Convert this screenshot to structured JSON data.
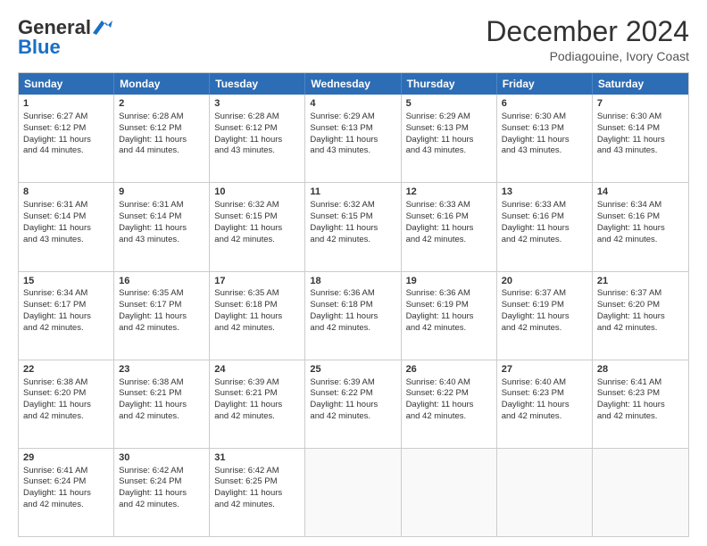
{
  "header": {
    "logo_general": "General",
    "logo_blue": "Blue",
    "month_title": "December 2024",
    "location": "Podiagouine, Ivory Coast"
  },
  "calendar": {
    "days_of_week": [
      "Sunday",
      "Monday",
      "Tuesday",
      "Wednesday",
      "Thursday",
      "Friday",
      "Saturday"
    ],
    "rows": [
      [
        {
          "num": "1",
          "info": "Sunrise: 6:27 AM\nSunset: 6:12 PM\nDaylight: 11 hours\nand 44 minutes."
        },
        {
          "num": "2",
          "info": "Sunrise: 6:28 AM\nSunset: 6:12 PM\nDaylight: 11 hours\nand 44 minutes."
        },
        {
          "num": "3",
          "info": "Sunrise: 6:28 AM\nSunset: 6:12 PM\nDaylight: 11 hours\nand 43 minutes."
        },
        {
          "num": "4",
          "info": "Sunrise: 6:29 AM\nSunset: 6:13 PM\nDaylight: 11 hours\nand 43 minutes."
        },
        {
          "num": "5",
          "info": "Sunrise: 6:29 AM\nSunset: 6:13 PM\nDaylight: 11 hours\nand 43 minutes."
        },
        {
          "num": "6",
          "info": "Sunrise: 6:30 AM\nSunset: 6:13 PM\nDaylight: 11 hours\nand 43 minutes."
        },
        {
          "num": "7",
          "info": "Sunrise: 6:30 AM\nSunset: 6:14 PM\nDaylight: 11 hours\nand 43 minutes."
        }
      ],
      [
        {
          "num": "8",
          "info": "Sunrise: 6:31 AM\nSunset: 6:14 PM\nDaylight: 11 hours\nand 43 minutes."
        },
        {
          "num": "9",
          "info": "Sunrise: 6:31 AM\nSunset: 6:14 PM\nDaylight: 11 hours\nand 43 minutes."
        },
        {
          "num": "10",
          "info": "Sunrise: 6:32 AM\nSunset: 6:15 PM\nDaylight: 11 hours\nand 42 minutes."
        },
        {
          "num": "11",
          "info": "Sunrise: 6:32 AM\nSunset: 6:15 PM\nDaylight: 11 hours\nand 42 minutes."
        },
        {
          "num": "12",
          "info": "Sunrise: 6:33 AM\nSunset: 6:16 PM\nDaylight: 11 hours\nand 42 minutes."
        },
        {
          "num": "13",
          "info": "Sunrise: 6:33 AM\nSunset: 6:16 PM\nDaylight: 11 hours\nand 42 minutes."
        },
        {
          "num": "14",
          "info": "Sunrise: 6:34 AM\nSunset: 6:16 PM\nDaylight: 11 hours\nand 42 minutes."
        }
      ],
      [
        {
          "num": "15",
          "info": "Sunrise: 6:34 AM\nSunset: 6:17 PM\nDaylight: 11 hours\nand 42 minutes."
        },
        {
          "num": "16",
          "info": "Sunrise: 6:35 AM\nSunset: 6:17 PM\nDaylight: 11 hours\nand 42 minutes."
        },
        {
          "num": "17",
          "info": "Sunrise: 6:35 AM\nSunset: 6:18 PM\nDaylight: 11 hours\nand 42 minutes."
        },
        {
          "num": "18",
          "info": "Sunrise: 6:36 AM\nSunset: 6:18 PM\nDaylight: 11 hours\nand 42 minutes."
        },
        {
          "num": "19",
          "info": "Sunrise: 6:36 AM\nSunset: 6:19 PM\nDaylight: 11 hours\nand 42 minutes."
        },
        {
          "num": "20",
          "info": "Sunrise: 6:37 AM\nSunset: 6:19 PM\nDaylight: 11 hours\nand 42 minutes."
        },
        {
          "num": "21",
          "info": "Sunrise: 6:37 AM\nSunset: 6:20 PM\nDaylight: 11 hours\nand 42 minutes."
        }
      ],
      [
        {
          "num": "22",
          "info": "Sunrise: 6:38 AM\nSunset: 6:20 PM\nDaylight: 11 hours\nand 42 minutes."
        },
        {
          "num": "23",
          "info": "Sunrise: 6:38 AM\nSunset: 6:21 PM\nDaylight: 11 hours\nand 42 minutes."
        },
        {
          "num": "24",
          "info": "Sunrise: 6:39 AM\nSunset: 6:21 PM\nDaylight: 11 hours\nand 42 minutes."
        },
        {
          "num": "25",
          "info": "Sunrise: 6:39 AM\nSunset: 6:22 PM\nDaylight: 11 hours\nand 42 minutes."
        },
        {
          "num": "26",
          "info": "Sunrise: 6:40 AM\nSunset: 6:22 PM\nDaylight: 11 hours\nand 42 minutes."
        },
        {
          "num": "27",
          "info": "Sunrise: 6:40 AM\nSunset: 6:23 PM\nDaylight: 11 hours\nand 42 minutes."
        },
        {
          "num": "28",
          "info": "Sunrise: 6:41 AM\nSunset: 6:23 PM\nDaylight: 11 hours\nand 42 minutes."
        }
      ],
      [
        {
          "num": "29",
          "info": "Sunrise: 6:41 AM\nSunset: 6:24 PM\nDaylight: 11 hours\nand 42 minutes."
        },
        {
          "num": "30",
          "info": "Sunrise: 6:42 AM\nSunset: 6:24 PM\nDaylight: 11 hours\nand 42 minutes."
        },
        {
          "num": "31",
          "info": "Sunrise: 6:42 AM\nSunset: 6:25 PM\nDaylight: 11 hours\nand 42 minutes."
        },
        {
          "num": "",
          "info": ""
        },
        {
          "num": "",
          "info": ""
        },
        {
          "num": "",
          "info": ""
        },
        {
          "num": "",
          "info": ""
        }
      ]
    ]
  }
}
